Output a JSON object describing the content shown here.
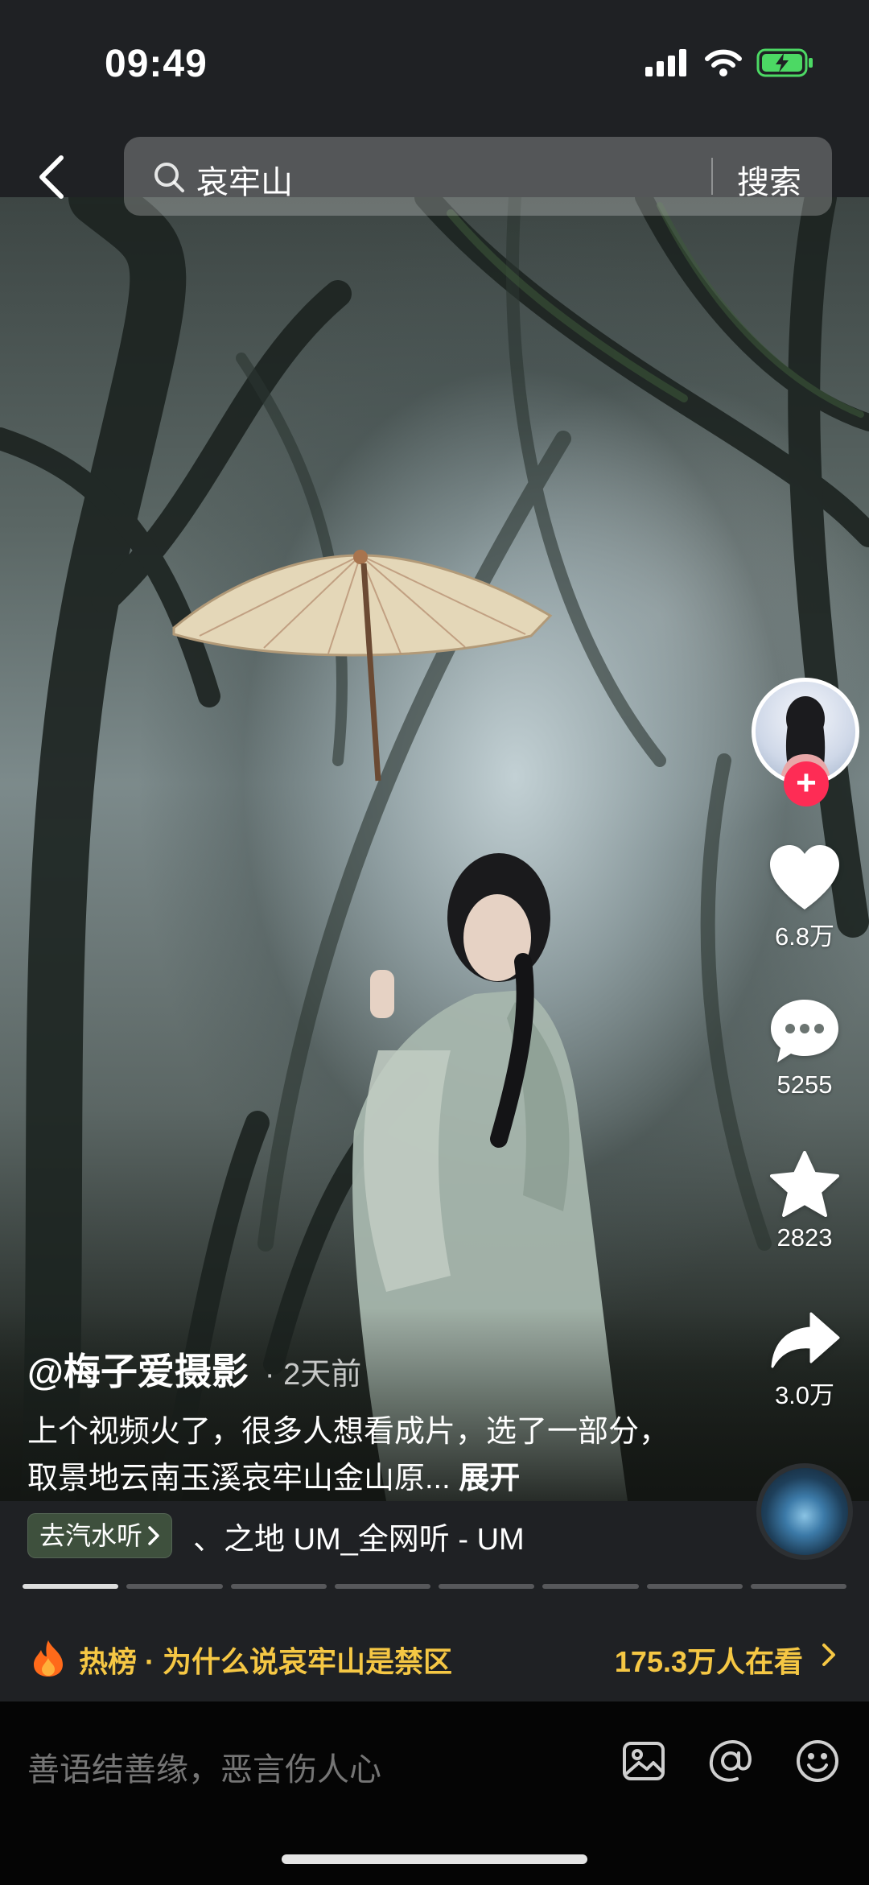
{
  "status_bar": {
    "time": "09:49"
  },
  "search": {
    "query": "哀牢山",
    "button_label": "搜索"
  },
  "author": {
    "handle": "@梅子爱摄影",
    "time_ago": "· 2天前"
  },
  "caption": {
    "text": "上个视频火了，很多人想看成片，选了一部分，取景地云南玉溪哀牢山金山原...",
    "expand_label": "展开"
  },
  "actions": {
    "like_count": "6.8万",
    "comment_count": "5255",
    "favorite_count": "2823",
    "share_count": "3.0万"
  },
  "music": {
    "chip_label": "去汽水听",
    "title": "、之地 UM_全网听 - UM"
  },
  "progress": {
    "segments": 8,
    "active_index": 0
  },
  "hot_banner": {
    "text": "热榜 · 为什么说哀牢山是禁区",
    "viewers": "175.3万人在看"
  },
  "comment_bar": {
    "placeholder": "善语结善缘，恶言伤人心"
  },
  "colors": {
    "accent_pink": "#fe2c55",
    "hot_yellow": "#f5c744",
    "background": "#1f2124"
  }
}
